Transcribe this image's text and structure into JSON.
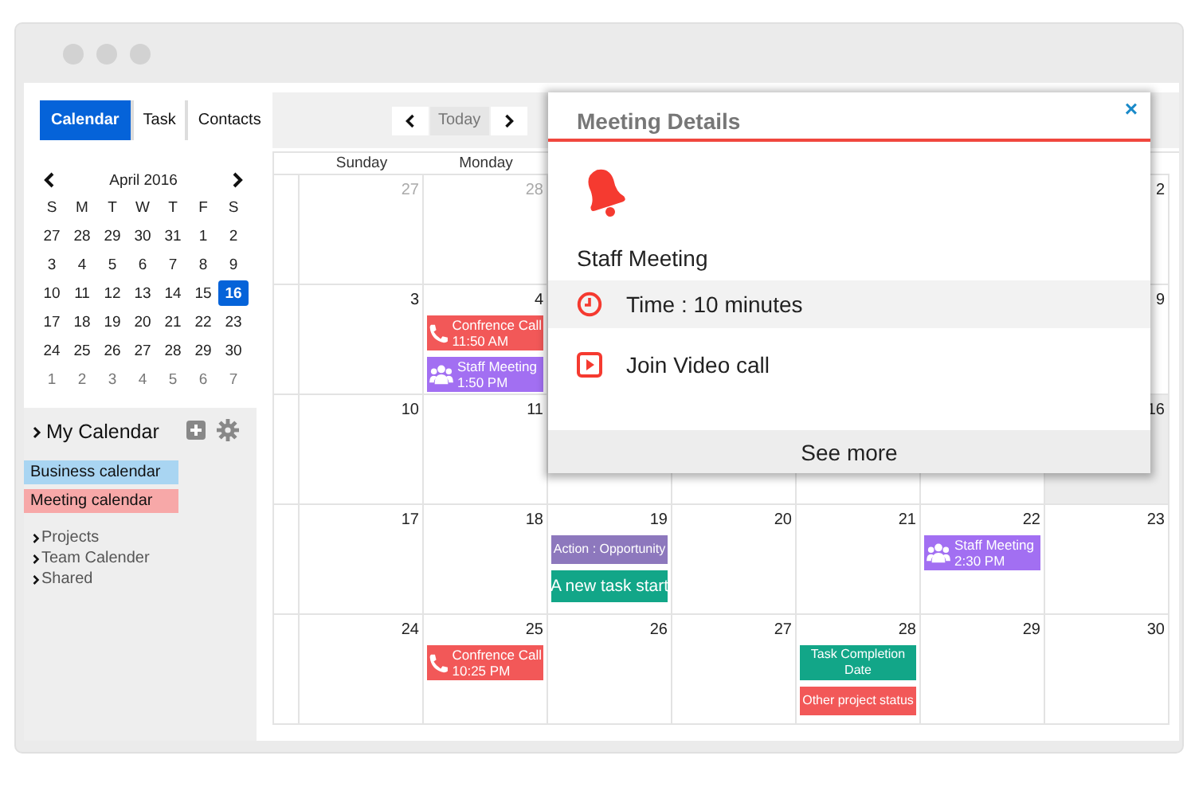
{
  "tabs": [
    {
      "label": "Calendar",
      "selected": true
    },
    {
      "label": "Task",
      "selected": false
    },
    {
      "label": "Contacts",
      "selected": false
    }
  ],
  "nav": {
    "today": "Today"
  },
  "mini_calendar": {
    "month": "April 2016",
    "weekdays": [
      "S",
      "M",
      "T",
      "W",
      "T",
      "F",
      "S"
    ],
    "weeks": [
      [
        {
          "day": "27",
          "muted": false
        },
        {
          "day": "28",
          "muted": false
        },
        {
          "day": "29",
          "muted": false
        },
        {
          "day": "30",
          "muted": false
        },
        {
          "day": "31",
          "muted": false
        },
        {
          "day": "1",
          "muted": false
        },
        {
          "day": "2",
          "muted": false
        }
      ],
      [
        {
          "day": "3",
          "muted": false
        },
        {
          "day": "4",
          "muted": false
        },
        {
          "day": "5",
          "muted": false
        },
        {
          "day": "6",
          "muted": false
        },
        {
          "day": "7",
          "muted": false
        },
        {
          "day": "8",
          "muted": false
        },
        {
          "day": "9",
          "muted": false
        }
      ],
      [
        {
          "day": "10",
          "muted": false
        },
        {
          "day": "11",
          "muted": false
        },
        {
          "day": "12",
          "muted": false
        },
        {
          "day": "13",
          "muted": false
        },
        {
          "day": "14",
          "muted": false
        },
        {
          "day": "15",
          "muted": false
        },
        {
          "day": "16",
          "muted": false,
          "selected": true
        }
      ],
      [
        {
          "day": "17",
          "muted": false
        },
        {
          "day": "18",
          "muted": false
        },
        {
          "day": "19",
          "muted": false
        },
        {
          "day": "20",
          "muted": false
        },
        {
          "day": "21",
          "muted": false
        },
        {
          "day": "22",
          "muted": false
        },
        {
          "day": "23",
          "muted": false
        }
      ],
      [
        {
          "day": "24",
          "muted": false
        },
        {
          "day": "25",
          "muted": false
        },
        {
          "day": "26",
          "muted": false
        },
        {
          "day": "27",
          "muted": false
        },
        {
          "day": "28",
          "muted": false
        },
        {
          "day": "29",
          "muted": false
        },
        {
          "day": "30",
          "muted": false
        }
      ],
      [
        {
          "day": "1",
          "muted": true
        },
        {
          "day": "2",
          "muted": true
        },
        {
          "day": "3",
          "muted": true
        },
        {
          "day": "4",
          "muted": true
        },
        {
          "day": "5",
          "muted": true
        },
        {
          "day": "6",
          "muted": true
        },
        {
          "day": "7",
          "muted": true
        }
      ]
    ]
  },
  "my_calendar": {
    "title": "My Calendar",
    "calendars": [
      {
        "name": "Business calendar",
        "color": "#a9d5f2"
      },
      {
        "name": "Meeting calendar",
        "color": "#f7a8a8"
      }
    ],
    "groups": [
      "Projects",
      "Team Calender",
      "Shared"
    ]
  },
  "month_view": {
    "weekdays": [
      "Sunday",
      "Monday"
    ],
    "weeks": [
      {
        "days": [
          {
            "day": "27",
            "muted": true
          },
          {
            "day": "28",
            "muted": true
          }
        ],
        "days_at_right": [
          {
            "day": "2",
            "muted": false
          }
        ]
      },
      {
        "days": [
          {
            "day": "3",
            "muted": false
          },
          {
            "day": "4",
            "muted": false,
            "events": [
              {
                "kind": "call",
                "title": "Confrence Call",
                "time": "11:50 AM",
                "color": "#f25858"
              },
              {
                "kind": "meeting",
                "title": "Staff Meeting",
                "time": "1:50 PM",
                "color": "#a26ff2"
              }
            ]
          }
        ],
        "days_at_right": [
          {
            "day": "9",
            "muted": false
          }
        ]
      },
      {
        "days": [
          {
            "day": "10",
            "muted": false
          },
          {
            "day": "11",
            "muted": false
          }
        ],
        "days_at_right": [
          {
            "day": "16",
            "muted": false,
            "today": true
          }
        ]
      },
      {
        "days": [
          {
            "day": "17",
            "muted": false
          },
          {
            "day": "18",
            "muted": false
          },
          {
            "day": "19",
            "muted": false,
            "events": [
              {
                "kind": "task",
                "title": "Action : Opportunity",
                "color": "#8d78bd"
              },
              {
                "kind": "task-large",
                "title": "A new task start",
                "color": "#12a688"
              }
            ]
          },
          {
            "day": "20",
            "muted": false
          },
          {
            "day": "21",
            "muted": false
          },
          {
            "day": "22",
            "muted": false,
            "events": [
              {
                "kind": "meeting",
                "title": "Staff Meeting",
                "time": "2:30 PM",
                "color": "#a26ff2"
              }
            ]
          },
          {
            "day": "23",
            "muted": false
          }
        ]
      },
      {
        "days": [
          {
            "day": "24",
            "muted": false
          },
          {
            "day": "25",
            "muted": false,
            "events": [
              {
                "kind": "call",
                "title": "Confrence Call",
                "time": "10:25 PM",
                "color": "#f25858"
              }
            ]
          },
          {
            "day": "26",
            "muted": false
          },
          {
            "day": "27",
            "muted": false
          },
          {
            "day": "28",
            "muted": false,
            "events": [
              {
                "kind": "task",
                "title": "Task Completion Date",
                "color": "#12a688"
              },
              {
                "kind": "task",
                "title": "Other project status",
                "color": "#f25858"
              }
            ]
          },
          {
            "day": "29",
            "muted": false
          },
          {
            "day": "30",
            "muted": false
          }
        ]
      }
    ]
  },
  "popup": {
    "title": "Meeting Details",
    "close": "×",
    "event": "Staff Meeting",
    "items": [
      {
        "kind": "time",
        "text": "Time : 10 minutes",
        "selected": true
      },
      {
        "kind": "video",
        "text": "Join Video call",
        "selected": false
      }
    ],
    "footer": "See more"
  }
}
